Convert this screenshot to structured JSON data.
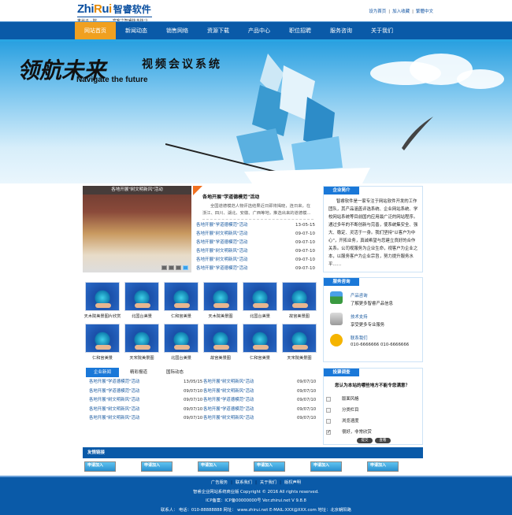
{
  "header": {
    "logo_en_a": "Zhi",
    "logo_en_b": "R",
    "logo_en_c": "u",
    "logo_en_d": "i",
    "logo_cn": "智睿软件",
    "slogan": "鬼谷子 · 揣　　　　宾客之智睿执多执少",
    "toplinks": [
      "设为首页",
      "加入收藏",
      "繁體中文"
    ]
  },
  "nav": {
    "items": [
      "网站首页",
      "新闻动态",
      "销售网络",
      "资源下载",
      "产品中心",
      "职位招聘",
      "服务咨询",
      "关于我们"
    ],
    "active": 0
  },
  "banner": {
    "title_cn": "领航未来",
    "subtitle_cn": "视频会议系统",
    "title_en": "Navigate the future"
  },
  "slideshow": {
    "caption": "各地开展\"树文明新风\"活动",
    "pages": 4,
    "active_page": 4
  },
  "news_top": {
    "headline": "各地开展\"学道德模范\"活动",
    "summary": "全国道德模范人物评选结果近日即将揭晓，连日来，在浙江、四川、湖北、安徽、广西等地，推选出来的道德模...",
    "items": [
      {
        "title": "各地开展\"学道德模范\"活动",
        "date": "13-05-15"
      },
      {
        "title": "各地开展\"树文明新风\"活动",
        "date": "09-07-10"
      },
      {
        "title": "各地开展\"学道德模范\"活动",
        "date": "09-07-10"
      },
      {
        "title": "各地开展\"树文明新风\"活动",
        "date": "09-07-10"
      },
      {
        "title": "各地开展\"树文明新风\"活动",
        "date": "09-07-10"
      },
      {
        "title": "各地开展\"学道德模范\"活动",
        "date": "09-07-10"
      }
    ]
  },
  "intro": {
    "title": "企业简介",
    "text": "智睿软件是一家专注于网站软件开发的工作团队，其产品涵盖评选系统、企业网站系统、学校网站系统等目前国内应用最广泛的网站程序。通过多年的不断创新与完善，使系统集安全、强大、稳定、灵活于一身。我们坚持\"以客户为中心\"，开拓业务，真诚希望与您建立良好的合作关系。公司视服务为企业生命，视客户为企业之本，以服务客户为企业宗旨，努力提升服务水平……"
  },
  "products": [
    {
      "label": "天木院美景图片欣赏"
    },
    {
      "label": "北国台美景"
    },
    {
      "label": "仁和宫美景"
    },
    {
      "label": "天木院美景图"
    },
    {
      "label": "北国台美景"
    },
    {
      "label": "故宫美景图"
    },
    {
      "label": "仁和宫美景"
    },
    {
      "label": "天宋院美景图"
    },
    {
      "label": "北国台美景"
    },
    {
      "label": "故宫美景图"
    },
    {
      "label": "仁和宫美景"
    },
    {
      "label": "天宋院美景图"
    }
  ],
  "service": {
    "title": "服务咨询",
    "items": [
      {
        "icon": "consult-icon",
        "title": "产品咨询",
        "desc": "了解更多智睿产品信息"
      },
      {
        "icon": "support-icon",
        "title": "技术支持",
        "desc": "享受更多专业服务"
      },
      {
        "icon": "phone-icon",
        "title": "联系我们",
        "desc": "010-6666666 010-6666666"
      }
    ]
  },
  "news_tabs": {
    "tabs": [
      "企业新闻",
      "精彩报道",
      "国际动态"
    ],
    "active": 0,
    "rows": [
      {
        "left": "各地开展\"学道德模范\"活动",
        "left_date": "13/05/15",
        "right": "各地开展\"树文明新风\"活动",
        "right_date": "09/07/10"
      },
      {
        "left": "各地开展\"学道德模范\"活动",
        "left_date": "09/07/10",
        "right": "各地开展\"树文明新风\"活动",
        "right_date": "09/07/10"
      },
      {
        "left": "各地开展\"树文明新风\"活动",
        "left_date": "09/07/10",
        "right": "各地开展\"学道德模范\"活动",
        "right_date": "09/07/10"
      },
      {
        "left": "各地开展\"树文明新风\"活动",
        "left_date": "09/07/10",
        "right": "各地开展\"学道德模范\"活动",
        "right_date": "09/07/10"
      },
      {
        "left": "各地开展\"树文明新风\"活动",
        "left_date": "09/07/10",
        "right": "各地开展\"树文明新风\"活动",
        "right_date": "09/07/10"
      }
    ]
  },
  "survey": {
    "title": "投票调查",
    "question": "您认为本站的哪些地方不能令您满意？",
    "options": [
      {
        "label": "版面风格",
        "checked": false
      },
      {
        "label": "分类栏目",
        "checked": false
      },
      {
        "label": "浏览速度",
        "checked": false
      },
      {
        "label": "很好，非常欣赏",
        "checked": true
      }
    ],
    "submit": "提交",
    "view": "查看"
  },
  "links": {
    "title": "友情链接",
    "logo_text": "申请加入",
    "count": 6
  },
  "footer": {
    "links": [
      "广告服务",
      "联系我们",
      "关于我们",
      "版权声明"
    ],
    "copyright": "智睿企业网站系统商业版 Copyright © 2016 All rights reserved.",
    "icp": "ICP备案：ICP备00000000号 Ver:zhirui.net V 9.8.8",
    "contact": "联系人：  电话：010-88888888 网址： www.zhirui.net E-MAIL:XXX@XXX.com 地址：北京朝阳路"
  }
}
